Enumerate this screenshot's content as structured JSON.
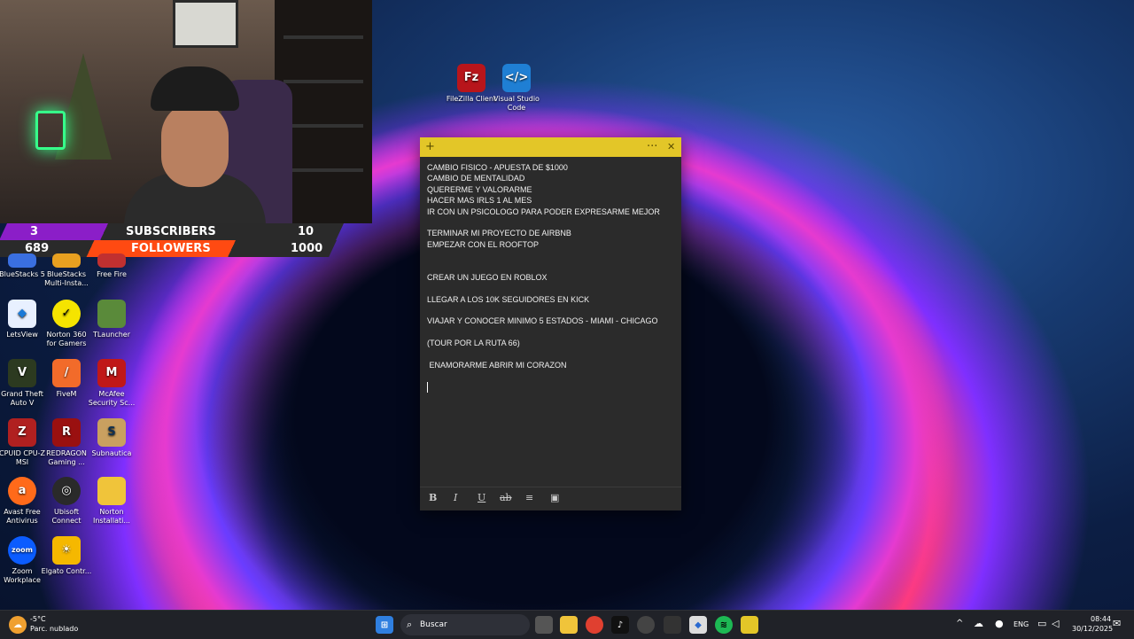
{
  "stream_overlay": {
    "subscribers": {
      "current": "3",
      "label": "SUBSCRIBERS",
      "goal": "10"
    },
    "followers": {
      "current": "689",
      "label": "FOLLOWERS",
      "goal": "1000"
    }
  },
  "desktop_top_icons": [
    {
      "label": "FileZilla Client",
      "icon": "filezilla-icon"
    },
    {
      "label": "Visual Studio Code",
      "icon": "vscode-icon"
    }
  ],
  "desktop_icons": [
    {
      "label": "BlueStacks 5"
    },
    {
      "label": "BlueStacks Multi-Insta..."
    },
    {
      "label": "Free Fire"
    },
    {
      "label": "LetsView"
    },
    {
      "label": "Norton 360 for Gamers"
    },
    {
      "label": "TLauncher"
    },
    {
      "label": "Grand Theft Auto V"
    },
    {
      "label": "FiveM"
    },
    {
      "label": "McAfee Security Sc..."
    },
    {
      "label": "CPUID CPU-Z MSI"
    },
    {
      "label": "REDRAGON Gaming ..."
    },
    {
      "label": "Subnautica"
    },
    {
      "label": "Avast Free Antivirus"
    },
    {
      "label": "Ubisoft Connect"
    },
    {
      "label": "Norton Installati..."
    },
    {
      "label": "Zoom Workplace"
    },
    {
      "label": "Elgato Contr..."
    }
  ],
  "sticky_note": {
    "add_glyph": "+",
    "menu_glyph": "···",
    "close_glyph": "✕",
    "lines": [
      "CAMBIO FISICO - APUESTA DE $1000",
      "CAMBIO DE MENTALIDAD",
      "QUERERME Y VALORARME",
      "HACER MAS IRLS 1 AL MES",
      "IR CON UN PSICOLOGO PARA PODER EXPRESARME MEJOR",
      "",
      "TERMINAR MI PROYECTO DE AIRBNB",
      "EMPEZAR CON EL ROOFTOP",
      "",
      "",
      "CREAR UN JUEGO EN ROBLOX",
      "",
      "LLEGAR A LOS 10K SEGUIDORES EN KICK",
      "",
      "VIAJAR Y CONOCER MINIMO 5 ESTADOS - MIAMI - CHICAGO",
      "",
      "(TOUR POR LA RUTA 66)",
      "",
      " ENAMORARME ABRIR MI CORAZON"
    ],
    "toolbar": [
      "B",
      "I",
      "U",
      "ab",
      "≡",
      "▣"
    ]
  },
  "taskbar": {
    "weather_temp": "-5°C",
    "weather_desc": "Parc. nublado",
    "search_placeholder": "Buscar",
    "language": "ENG",
    "time": "08:44",
    "date": "30/12/2025"
  }
}
